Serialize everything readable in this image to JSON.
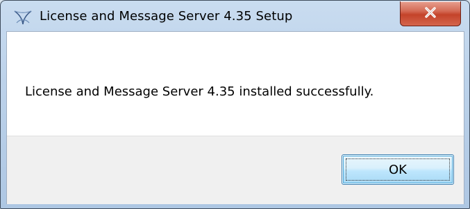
{
  "window": {
    "title": "License and Message Server 4.35 Setup",
    "app_icon": "setup-swirl-icon",
    "close_icon": "close-x-icon"
  },
  "dialog": {
    "message": "License and Message Server 4.35 installed successfully.",
    "ok_label": "OK"
  },
  "colors": {
    "titlebar": "#bcd2ea",
    "close_button": "#c4432a",
    "footer": "#f0f0f0",
    "ok_button_border": "#3c7fb1"
  }
}
